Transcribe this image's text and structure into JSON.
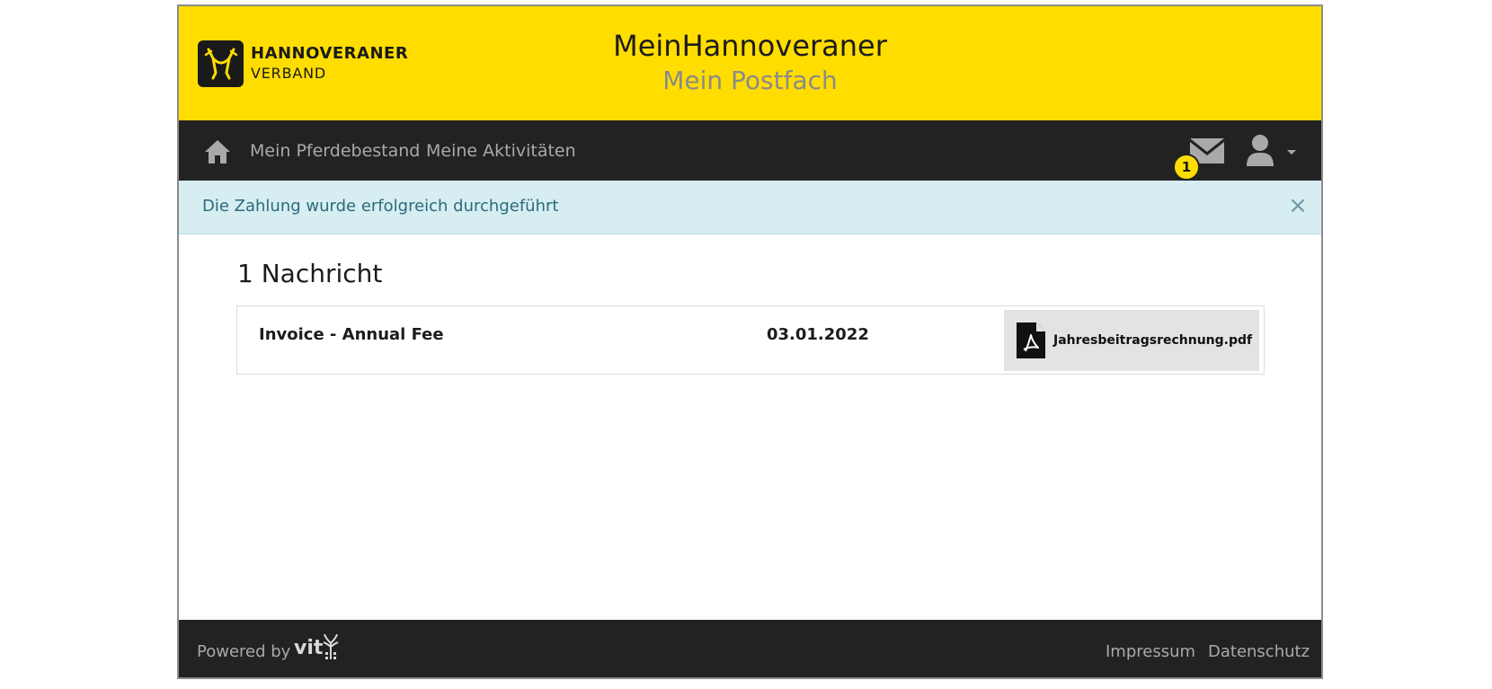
{
  "brand": {
    "logo_line1": "HANNOVERANER",
    "logo_line2": "VERBAND",
    "logo_icon": "hannoveraner-horse-heads-logo",
    "accent_color": "#ffdd00",
    "dark_color": "#222222"
  },
  "header": {
    "title": "MeinHannoveraner",
    "subtitle": "Mein Postfach"
  },
  "nav": {
    "home_icon": "home-icon",
    "links": [
      {
        "label": "Mein Pferdebestand"
      },
      {
        "label": "Meine Aktivitäten"
      }
    ],
    "mail_icon": "envelope-icon",
    "mail_badge": "1",
    "user_icon": "user-icon"
  },
  "alert": {
    "text": "Die Zahlung wurde erfolgreich durchgeführt",
    "close": "×",
    "bg_color": "#d6edf2"
  },
  "content": {
    "title": "1 Nachricht",
    "messages": [
      {
        "subject": "Invoice - Annual Fee",
        "date": "03.01.2022",
        "attachment": "Jahresbeitragsrechnung.pdf",
        "attachment_icon": "pdf-file-icon"
      }
    ]
  },
  "footer": {
    "powered_by": "Powered by",
    "vit_logo": "vit",
    "links": [
      {
        "label": "Impressum"
      },
      {
        "label": "Datenschutz"
      }
    ]
  }
}
